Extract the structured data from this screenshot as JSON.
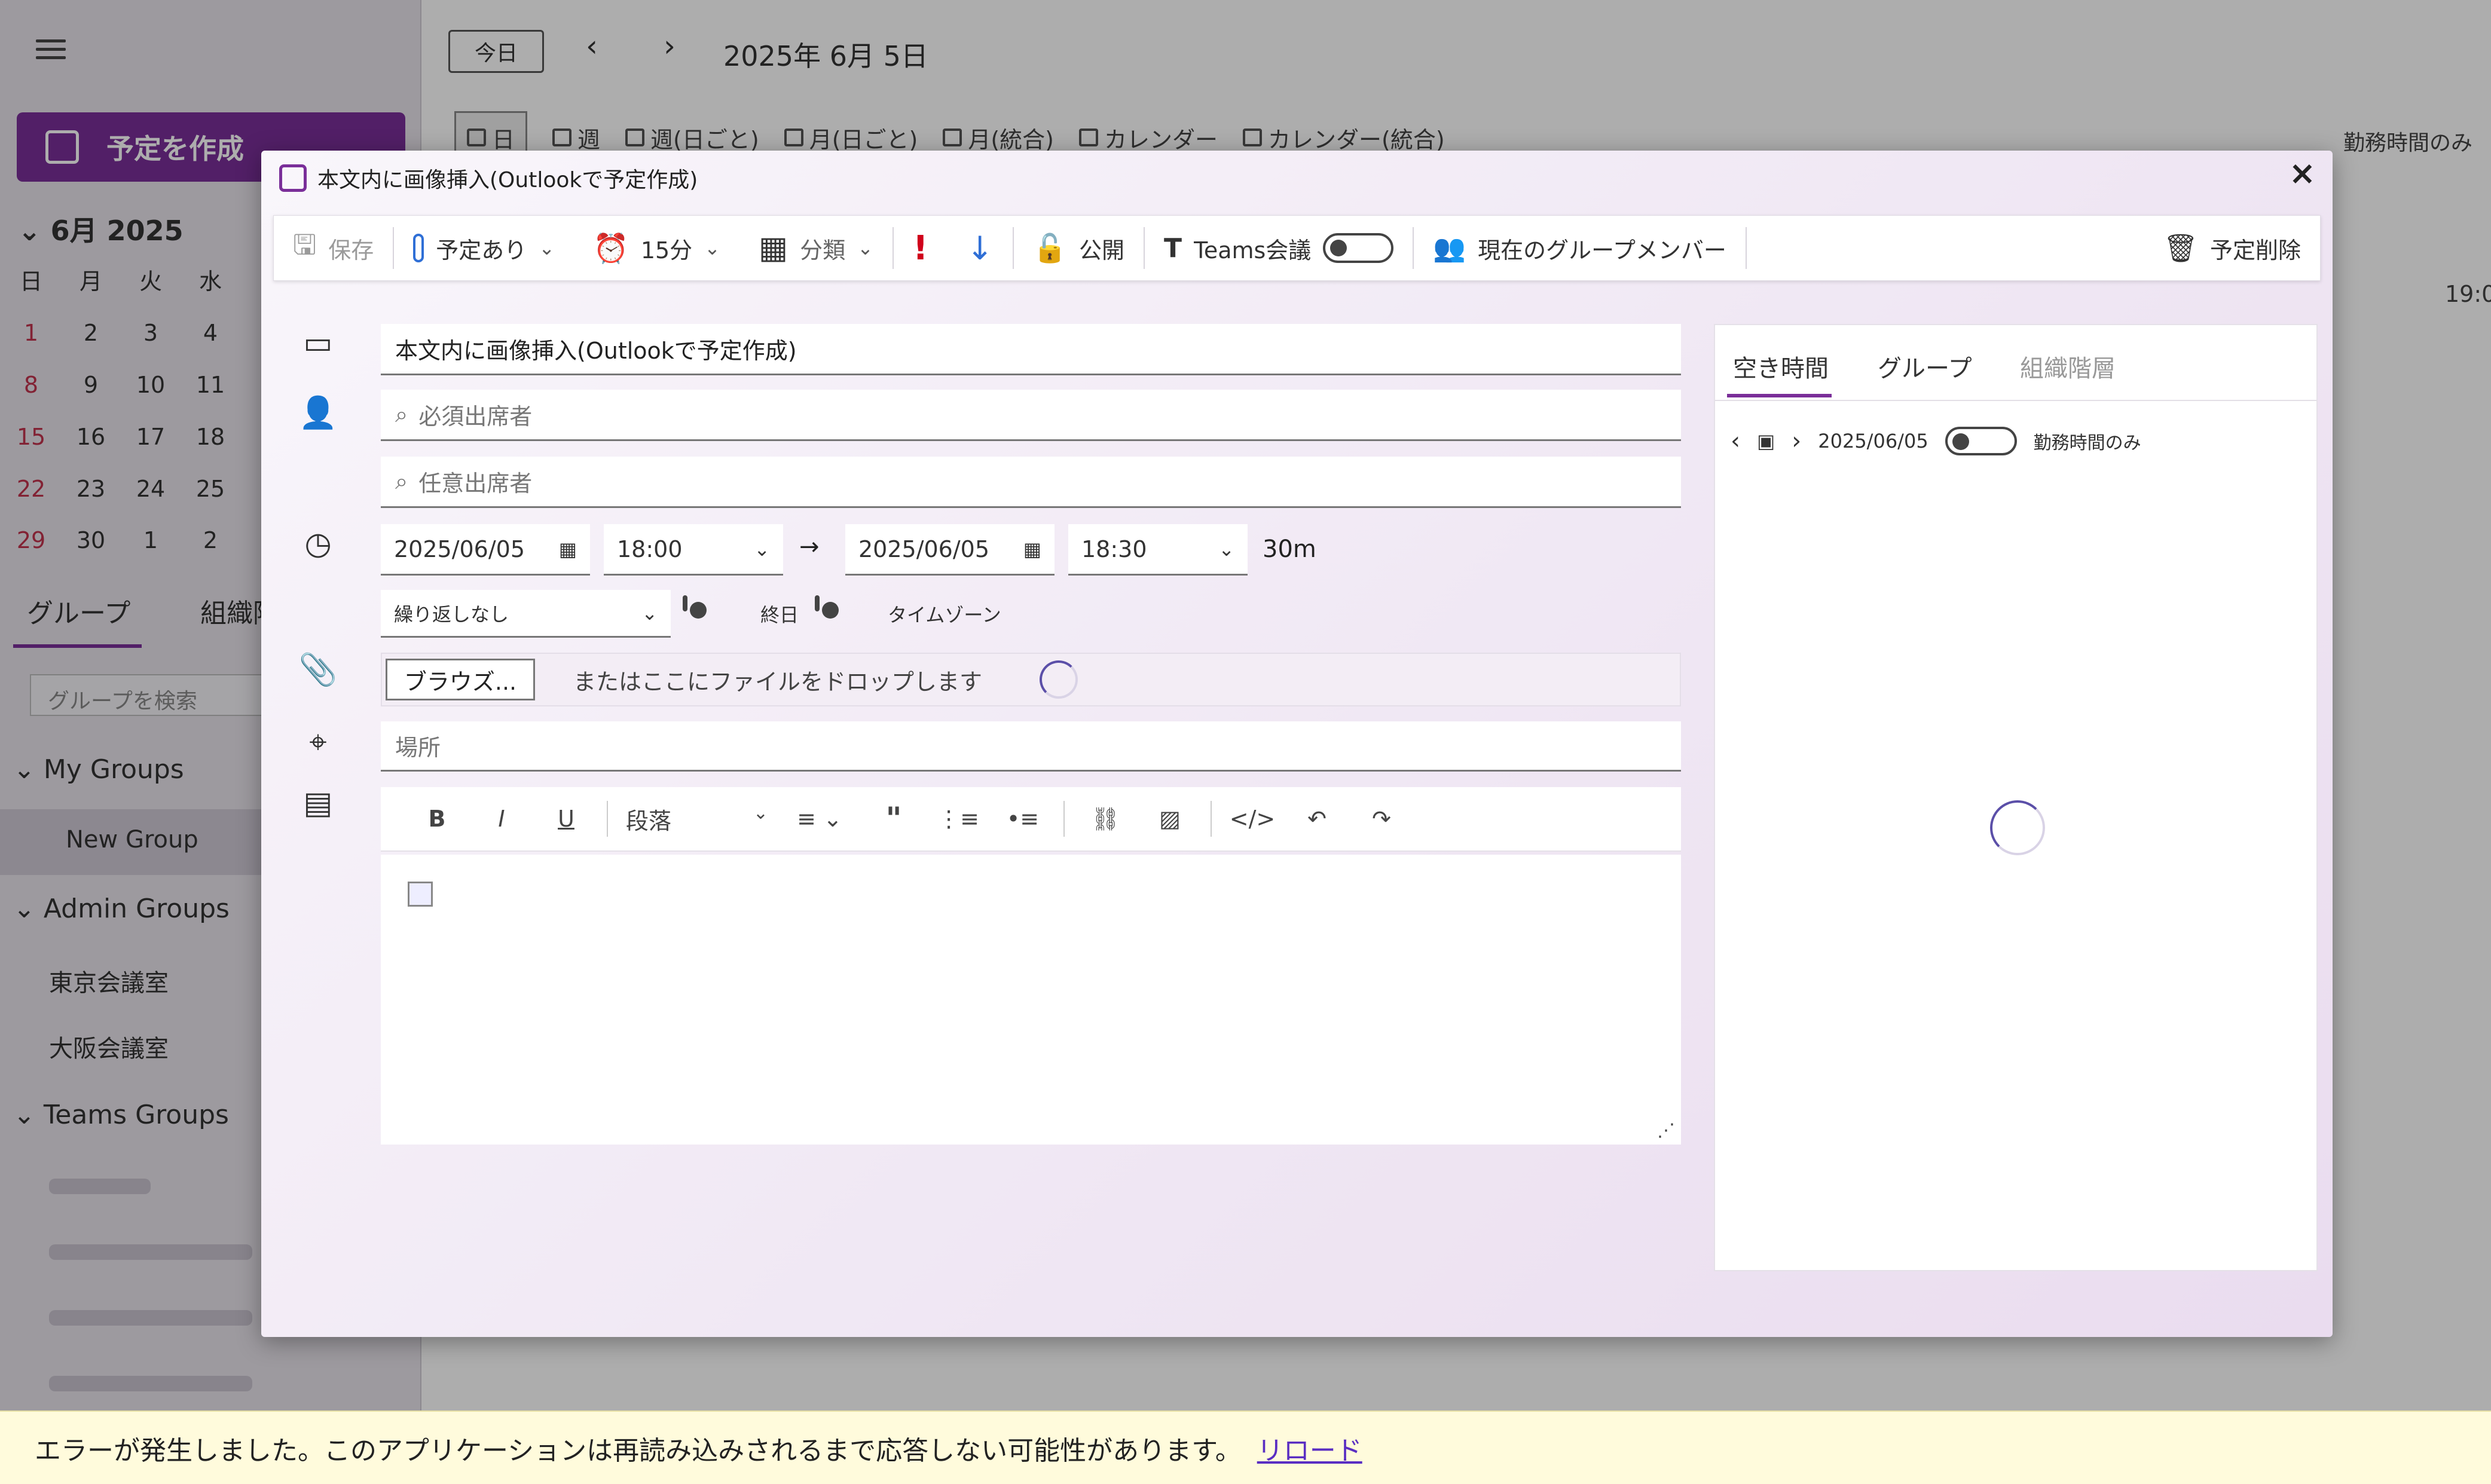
{
  "app": {
    "create_button": "予定を作成",
    "month_label": "6月 2025",
    "weekdays": [
      "日",
      "月",
      "火",
      "水"
    ],
    "calendar_rows": [
      [
        "1",
        "2",
        "3",
        "4"
      ],
      [
        "8",
        "9",
        "10",
        "11"
      ],
      [
        "15",
        "16",
        "17",
        "18"
      ],
      [
        "22",
        "23",
        "24",
        "25"
      ],
      [
        "29",
        "30",
        "1",
        "2"
      ]
    ],
    "left_tabs": [
      "グループ",
      "組織階"
    ],
    "group_search_placeholder": "グループを検索",
    "tree": {
      "my_groups": "My Groups",
      "new_group": "New Group",
      "admin_groups": "Admin Groups",
      "rooms": [
        "東京会議室",
        "大阪会議室"
      ],
      "teams_groups": "Teams Groups"
    },
    "today_button": "今日",
    "date_heading": "2025年 6月 5日",
    "view_tabs": [
      "日",
      "週",
      "週(日ごと)",
      "月(日ごと)",
      "月(統合)",
      "カレンダー",
      "カレンダー(統合)"
    ],
    "work_hours_only": "勤務時間のみ",
    "time_label": "19:0"
  },
  "modal": {
    "title": "本文内に画像挿入(Outlookで予定作成)",
    "toolbar": {
      "save": "保存",
      "status": "予定あり",
      "reminder": "15分",
      "category": "分類",
      "visibility": "公開",
      "teams": "Teams会議",
      "group_members": "現在のグループメンバー",
      "delete": "予定削除"
    },
    "subject": "本文内に画像挿入(Outlookで予定作成)",
    "required_placeholder": "必須出席者",
    "optional_placeholder": "任意出席者",
    "start_date": "2025/06/05",
    "start_time": "18:00",
    "end_date": "2025/06/05",
    "end_time": "18:30",
    "duration": "30m",
    "arrow": "→",
    "recurrence": "繰り返しなし",
    "all_day": "終日",
    "timezone": "タイムゾーン",
    "browse_button": "ブラウズ...",
    "drop_text": "またはここにファイルをドロップします",
    "location_placeholder": "場所",
    "paragraph_select": "段落",
    "right_panel": {
      "tabs": [
        "空き時間",
        "グループ",
        "組織階層"
      ],
      "date": "2025/06/05",
      "work_hours_only": "勤務時間のみ"
    }
  },
  "error_bar": {
    "message": "エラーが発生しました。このアプリケーションは再読み込みされるまで応答しない可能性があります。",
    "reload_link": "リロード"
  },
  "colors": {
    "accent": "#7a2e99",
    "priority_high": "#d0021b",
    "priority_low": "#2f6fd6",
    "error_bg": "#fffbdc"
  }
}
